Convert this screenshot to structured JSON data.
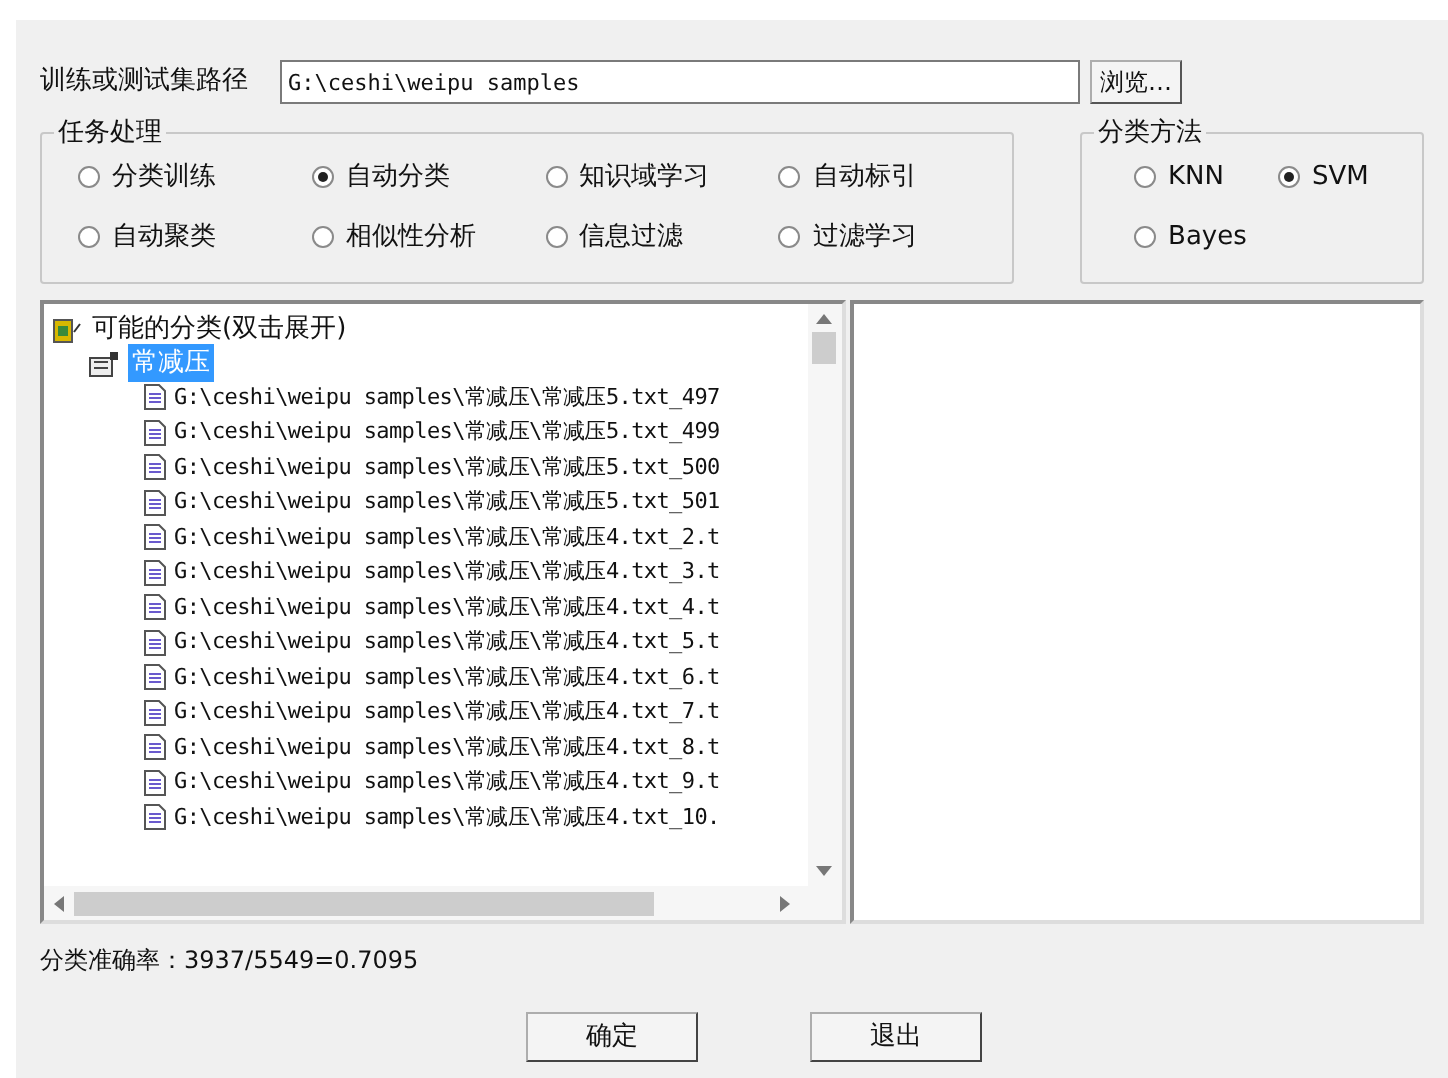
{
  "path_label": "训练或测试集路径",
  "path_field": {
    "value": "G:\\ceshi\\weipu samples"
  },
  "browse_button": "浏览…",
  "task_group": {
    "title": "任务处理",
    "options": [
      {
        "label": "分类训练",
        "selected": false
      },
      {
        "label": "自动分类",
        "selected": true
      },
      {
        "label": "知识域学习",
        "selected": false
      },
      {
        "label": "自动标引",
        "selected": false
      },
      {
        "label": "自动聚类",
        "selected": false
      },
      {
        "label": "相似性分析",
        "selected": false
      },
      {
        "label": "信息过滤",
        "selected": false
      },
      {
        "label": "过滤学习",
        "selected": false
      }
    ]
  },
  "method_group": {
    "title": "分类方法",
    "options": [
      {
        "label": "KNN",
        "selected": false
      },
      {
        "label": "SVM",
        "selected": true
      },
      {
        "label": "Bayes",
        "selected": false
      }
    ]
  },
  "tree": {
    "label": "可能的分类(双击展开)",
    "expanded": true,
    "children": [
      {
        "label": "常减压",
        "selected": true,
        "children": [
          {
            "label": "G:\\ceshi\\weipu samples\\常减压\\常减压5.txt_497"
          },
          {
            "label": "G:\\ceshi\\weipu samples\\常减压\\常减压5.txt_499"
          },
          {
            "label": "G:\\ceshi\\weipu samples\\常减压\\常减压5.txt_500"
          },
          {
            "label": "G:\\ceshi\\weipu samples\\常减压\\常减压5.txt_501"
          },
          {
            "label": "G:\\ceshi\\weipu samples\\常减压\\常减压4.txt_2.t"
          },
          {
            "label": "G:\\ceshi\\weipu samples\\常减压\\常减压4.txt_3.t"
          },
          {
            "label": "G:\\ceshi\\weipu samples\\常减压\\常减压4.txt_4.t"
          },
          {
            "label": "G:\\ceshi\\weipu samples\\常减压\\常减压4.txt_5.t"
          },
          {
            "label": "G:\\ceshi\\weipu samples\\常减压\\常减压4.txt_6.t"
          },
          {
            "label": "G:\\ceshi\\weipu samples\\常减压\\常减压4.txt_7.t"
          },
          {
            "label": "G:\\ceshi\\weipu samples\\常减压\\常减压4.txt_8.t"
          },
          {
            "label": "G:\\ceshi\\weipu samples\\常减压\\常减压4.txt_9.t"
          },
          {
            "label": "G:\\ceshi\\weipu samples\\常减压\\常减压4.txt_10."
          }
        ]
      }
    ]
  },
  "status": "分类准确率：3937/5549=0.7095",
  "buttons": [
    "确定",
    "退出"
  ]
}
